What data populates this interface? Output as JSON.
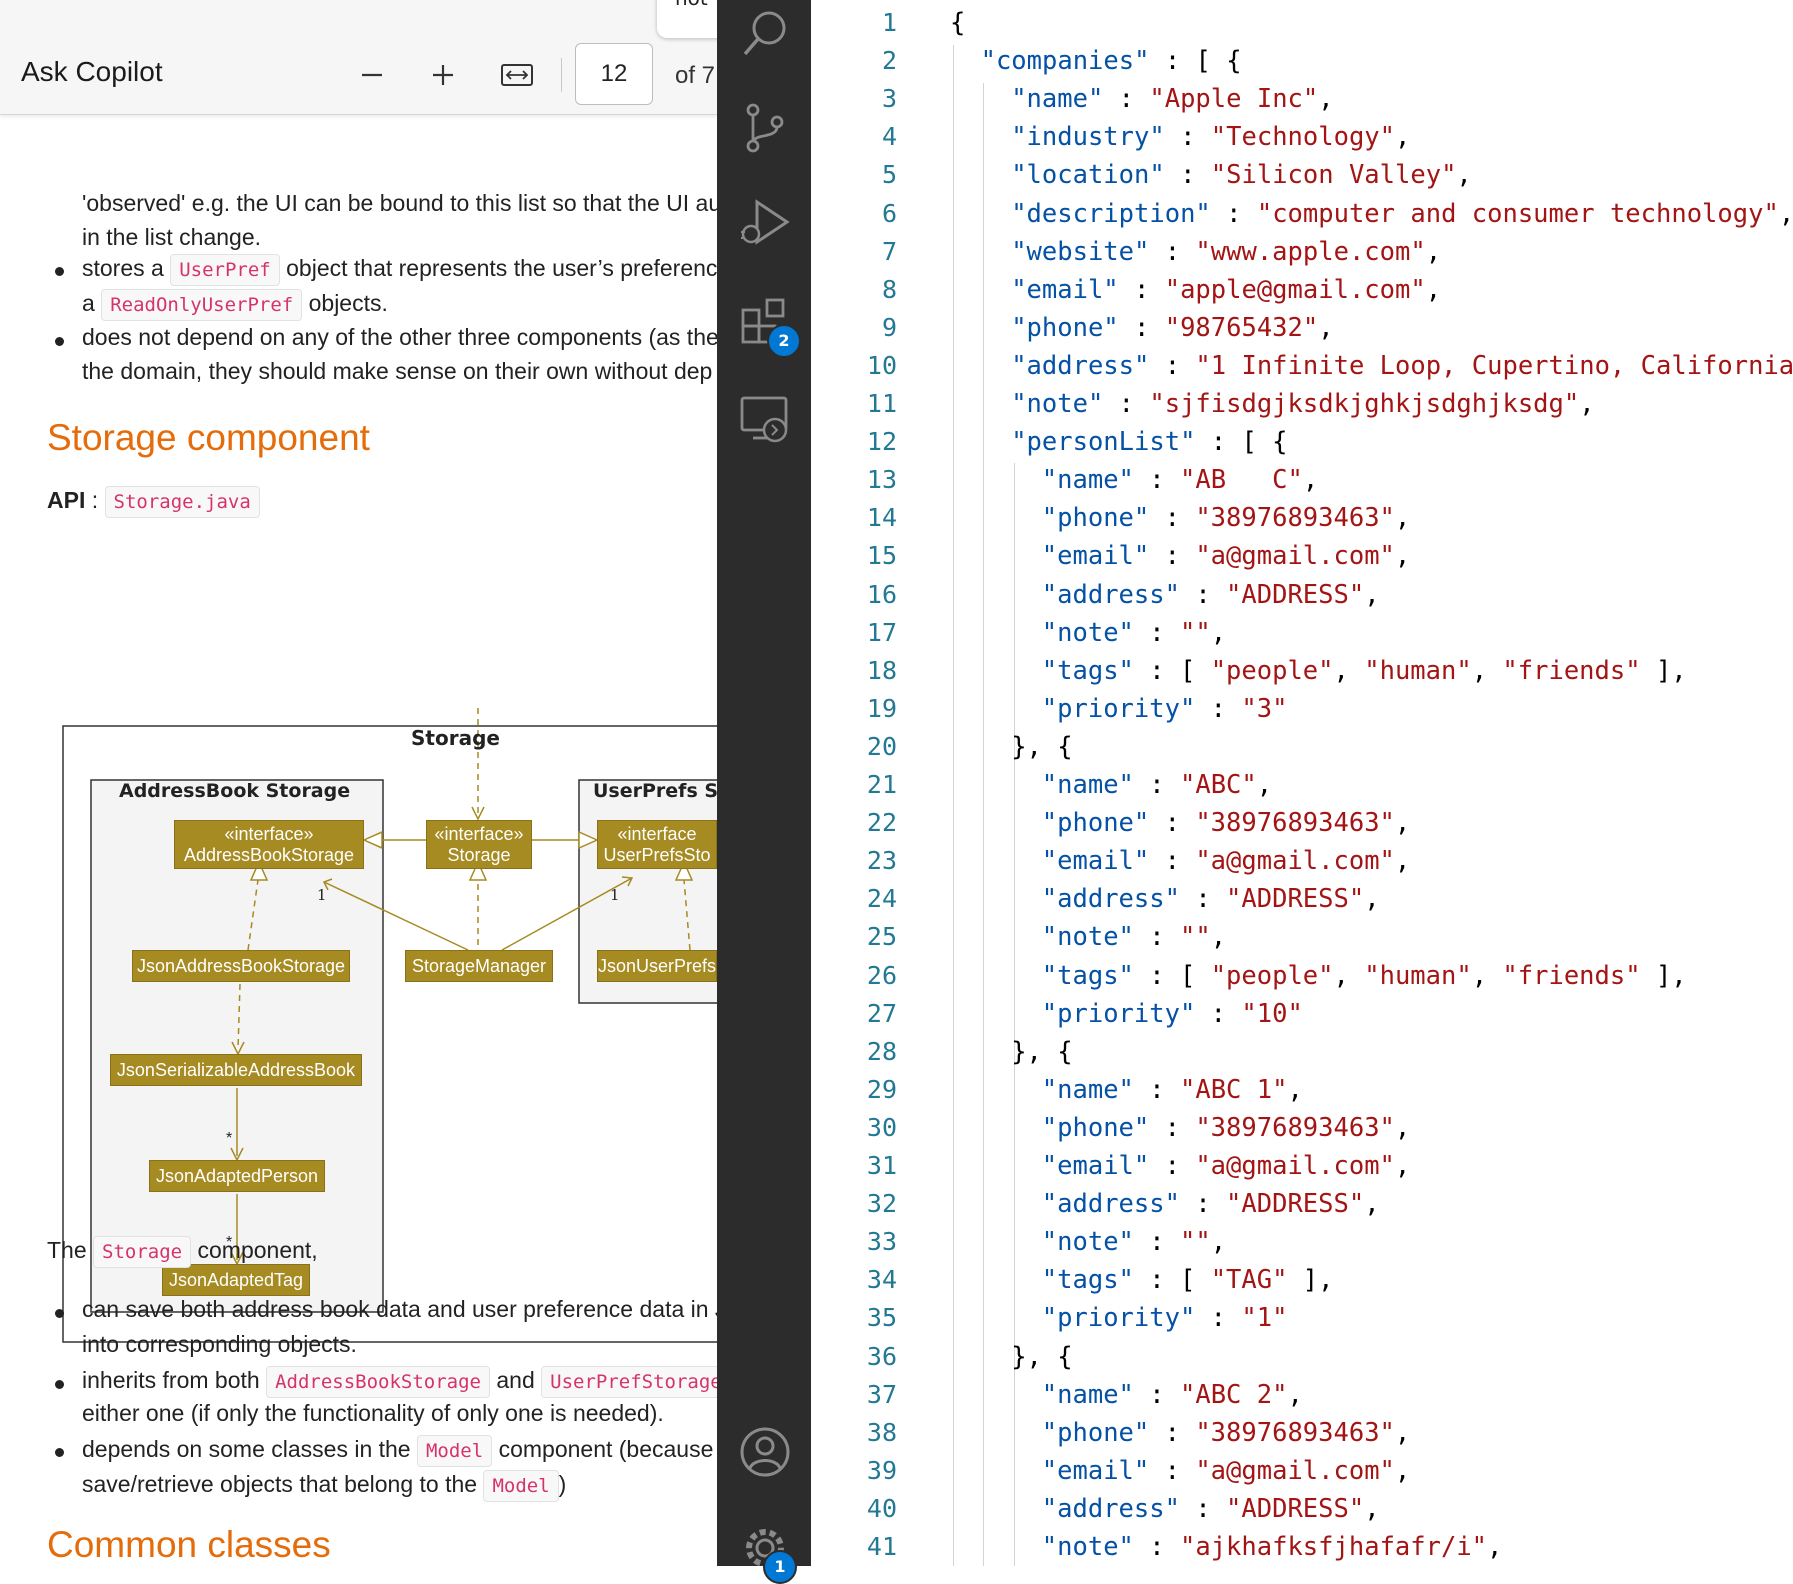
{
  "pdf_toolbar": {
    "tab_stub_text": "not",
    "ask_copilot": "Ask Copilot",
    "zoom_out": "–",
    "zoom_in": "+",
    "page_number": "12",
    "page_of": "of 7"
  },
  "doc": {
    "para1_line1": "'observed' e.g. the UI can be bound to this list so that the UI au",
    "para1_line2": "in the list change.",
    "b1_pre": "stores a",
    "b1_code": "UserPref",
    "b1_post": "object that represents the user’s preference",
    "b1_line2_pre": "a",
    "b1_line2_code": "ReadOnlyUserPref",
    "b1_line2_post": "objects.",
    "b2_line1": "does not depend on any of the other three components (as the",
    "b2_line2": "the domain, they should make sense on their own without dep",
    "storage_heading": "Storage component",
    "api_label": "API",
    "api_sep": ":",
    "api_code": "Storage.java",
    "the_label": "The",
    "storage_code": "Storage",
    "component_label": "component,",
    "c1_line1": "can save both address book data and user preference data in J",
    "c1_line2": "into corresponding objects.",
    "c2_pre": "inherits from both",
    "c2_code1": "AddressBookStorage",
    "c2_and": "and",
    "c2_code2": "UserPrefStorage",
    "c2_line2": "either one (if only the functionality of only one is needed).",
    "c3_pre": "depends on some classes in the",
    "c3_code": "Model",
    "c3_post": "component (because t",
    "c3_line2_pre": "save/retrieve objects that belong to the",
    "c3_line2_code": "Model",
    "c3_line2_post": ")",
    "common_heading": "Common classes"
  },
  "diagram": {
    "outer_title": "Storage",
    "addressbook_pkg": "AddressBook Storage",
    "userprefs_pkg": "UserPrefs S",
    "abs_stereo": "«interface»",
    "abs_name": "AddressBookStorage",
    "storage_stereo": "«interface»",
    "storage_name": "Storage",
    "ups_stereo": "«interface",
    "ups_name": "UserPrefsSto",
    "json_abs": "JsonAddressBookStorage",
    "storage_manager": "StorageManager",
    "json_ups": "JsonUserPrefs",
    "json_sab": "JsonSerializableAddressBook",
    "json_person": "JsonAdaptedPerson",
    "json_tag": "JsonAdaptedTag",
    "mult_one_a": "1",
    "mult_one_b": "1",
    "mult_many_a": "*",
    "mult_many_b": "*"
  },
  "activity_bar": {
    "icons": [
      "search-icon",
      "source-control-icon",
      "run-debug-icon",
      "extensions-icon",
      "remote-explorer-icon",
      "account-icon",
      "settings-gear-icon"
    ],
    "extensions_badge": "2",
    "settings_badge": "1"
  },
  "editor": {
    "lines": [
      {
        "n": "1",
        "indent": 0,
        "segs": [
          [
            "p",
            "{"
          ]
        ]
      },
      {
        "n": "2",
        "indent": 1,
        "segs": [
          [
            "k",
            "\"companies\""
          ],
          [
            "p",
            " : [ {"
          ]
        ]
      },
      {
        "n": "3",
        "indent": 2,
        "segs": [
          [
            "k",
            "\"name\""
          ],
          [
            "p",
            " : "
          ],
          [
            "s",
            "\"Apple Inc\""
          ],
          [
            "p",
            ","
          ]
        ]
      },
      {
        "n": "4",
        "indent": 2,
        "segs": [
          [
            "k",
            "\"industry\""
          ],
          [
            "p",
            " : "
          ],
          [
            "s",
            "\"Technology\""
          ],
          [
            "p",
            ","
          ]
        ]
      },
      {
        "n": "5",
        "indent": 2,
        "segs": [
          [
            "k",
            "\"location\""
          ],
          [
            "p",
            " : "
          ],
          [
            "s",
            "\"Silicon Valley\""
          ],
          [
            "p",
            ","
          ]
        ]
      },
      {
        "n": "6",
        "indent": 2,
        "segs": [
          [
            "k",
            "\"description\""
          ],
          [
            "p",
            " : "
          ],
          [
            "s",
            "\"computer and consumer technology\""
          ],
          [
            "p",
            ","
          ]
        ]
      },
      {
        "n": "7",
        "indent": 2,
        "segs": [
          [
            "k",
            "\"website\""
          ],
          [
            "p",
            " : "
          ],
          [
            "s",
            "\"www.apple.com\""
          ],
          [
            "p",
            ","
          ]
        ]
      },
      {
        "n": "8",
        "indent": 2,
        "segs": [
          [
            "k",
            "\"email\""
          ],
          [
            "p",
            " : "
          ],
          [
            "s",
            "\"apple@gmail.com\""
          ],
          [
            "p",
            ","
          ]
        ]
      },
      {
        "n": "9",
        "indent": 2,
        "segs": [
          [
            "k",
            "\"phone\""
          ],
          [
            "p",
            " : "
          ],
          [
            "s",
            "\"98765432\""
          ],
          [
            "p",
            ","
          ]
        ]
      },
      {
        "n": "10",
        "indent": 2,
        "segs": [
          [
            "k",
            "\"address\""
          ],
          [
            "p",
            " : "
          ],
          [
            "s",
            "\"1 Infinite Loop, Cupertino, California"
          ]
        ]
      },
      {
        "n": "11",
        "indent": 2,
        "segs": [
          [
            "k",
            "\"note\""
          ],
          [
            "p",
            " : "
          ],
          [
            "s",
            "\"sjfisdgjksdkjghkjsdghjksdg\""
          ],
          [
            "p",
            ","
          ]
        ]
      },
      {
        "n": "12",
        "indent": 2,
        "segs": [
          [
            "k",
            "\"personList\""
          ],
          [
            "p",
            " : [ {"
          ]
        ]
      },
      {
        "n": "13",
        "indent": 3,
        "segs": [
          [
            "k",
            "\"name\""
          ],
          [
            "p",
            " : "
          ],
          [
            "s",
            "\"AB   C\""
          ],
          [
            "p",
            ","
          ]
        ]
      },
      {
        "n": "14",
        "indent": 3,
        "segs": [
          [
            "k",
            "\"phone\""
          ],
          [
            "p",
            " : "
          ],
          [
            "s",
            "\"38976893463\""
          ],
          [
            "p",
            ","
          ]
        ]
      },
      {
        "n": "15",
        "indent": 3,
        "segs": [
          [
            "k",
            "\"email\""
          ],
          [
            "p",
            " : "
          ],
          [
            "s",
            "\"a@gmail.com\""
          ],
          [
            "p",
            ","
          ]
        ]
      },
      {
        "n": "16",
        "indent": 3,
        "segs": [
          [
            "k",
            "\"address\""
          ],
          [
            "p",
            " : "
          ],
          [
            "s",
            "\"ADDRESS\""
          ],
          [
            "p",
            ","
          ]
        ]
      },
      {
        "n": "17",
        "indent": 3,
        "segs": [
          [
            "k",
            "\"note\""
          ],
          [
            "p",
            " : "
          ],
          [
            "s",
            "\"\""
          ],
          [
            "p",
            ","
          ]
        ]
      },
      {
        "n": "18",
        "indent": 3,
        "segs": [
          [
            "k",
            "\"tags\""
          ],
          [
            "p",
            " : [ "
          ],
          [
            "s",
            "\"people\""
          ],
          [
            "p",
            ", "
          ],
          [
            "s",
            "\"human\""
          ],
          [
            "p",
            ", "
          ],
          [
            "s",
            "\"friends\""
          ],
          [
            "p",
            " ],"
          ]
        ]
      },
      {
        "n": "19",
        "indent": 3,
        "segs": [
          [
            "k",
            "\"priority\""
          ],
          [
            "p",
            " : "
          ],
          [
            "s",
            "\"3\""
          ]
        ]
      },
      {
        "n": "20",
        "indent": 2,
        "segs": [
          [
            "p",
            "}, {"
          ]
        ]
      },
      {
        "n": "21",
        "indent": 3,
        "segs": [
          [
            "k",
            "\"name\""
          ],
          [
            "p",
            " : "
          ],
          [
            "s",
            "\"ABC\""
          ],
          [
            "p",
            ","
          ]
        ]
      },
      {
        "n": "22",
        "indent": 3,
        "segs": [
          [
            "k",
            "\"phone\""
          ],
          [
            "p",
            " : "
          ],
          [
            "s",
            "\"38976893463\""
          ],
          [
            "p",
            ","
          ]
        ]
      },
      {
        "n": "23",
        "indent": 3,
        "segs": [
          [
            "k",
            "\"email\""
          ],
          [
            "p",
            " : "
          ],
          [
            "s",
            "\"a@gmail.com\""
          ],
          [
            "p",
            ","
          ]
        ]
      },
      {
        "n": "24",
        "indent": 3,
        "segs": [
          [
            "k",
            "\"address\""
          ],
          [
            "p",
            " : "
          ],
          [
            "s",
            "\"ADDRESS\""
          ],
          [
            "p",
            ","
          ]
        ]
      },
      {
        "n": "25",
        "indent": 3,
        "segs": [
          [
            "k",
            "\"note\""
          ],
          [
            "p",
            " : "
          ],
          [
            "s",
            "\"\""
          ],
          [
            "p",
            ","
          ]
        ]
      },
      {
        "n": "26",
        "indent": 3,
        "segs": [
          [
            "k",
            "\"tags\""
          ],
          [
            "p",
            " : [ "
          ],
          [
            "s",
            "\"people\""
          ],
          [
            "p",
            ", "
          ],
          [
            "s",
            "\"human\""
          ],
          [
            "p",
            ", "
          ],
          [
            "s",
            "\"friends\""
          ],
          [
            "p",
            " ],"
          ]
        ]
      },
      {
        "n": "27",
        "indent": 3,
        "segs": [
          [
            "k",
            "\"priority\""
          ],
          [
            "p",
            " : "
          ],
          [
            "s",
            "\"10\""
          ]
        ]
      },
      {
        "n": "28",
        "indent": 2,
        "segs": [
          [
            "p",
            "}, {"
          ]
        ]
      },
      {
        "n": "29",
        "indent": 3,
        "segs": [
          [
            "k",
            "\"name\""
          ],
          [
            "p",
            " : "
          ],
          [
            "s",
            "\"ABC 1\""
          ],
          [
            "p",
            ","
          ]
        ]
      },
      {
        "n": "30",
        "indent": 3,
        "segs": [
          [
            "k",
            "\"phone\""
          ],
          [
            "p",
            " : "
          ],
          [
            "s",
            "\"38976893463\""
          ],
          [
            "p",
            ","
          ]
        ]
      },
      {
        "n": "31",
        "indent": 3,
        "segs": [
          [
            "k",
            "\"email\""
          ],
          [
            "p",
            " : "
          ],
          [
            "s",
            "\"a@gmail.com\""
          ],
          [
            "p",
            ","
          ]
        ]
      },
      {
        "n": "32",
        "indent": 3,
        "segs": [
          [
            "k",
            "\"address\""
          ],
          [
            "p",
            " : "
          ],
          [
            "s",
            "\"ADDRESS\""
          ],
          [
            "p",
            ","
          ]
        ]
      },
      {
        "n": "33",
        "indent": 3,
        "segs": [
          [
            "k",
            "\"note\""
          ],
          [
            "p",
            " : "
          ],
          [
            "s",
            "\"\""
          ],
          [
            "p",
            ","
          ]
        ]
      },
      {
        "n": "34",
        "indent": 3,
        "segs": [
          [
            "k",
            "\"tags\""
          ],
          [
            "p",
            " : [ "
          ],
          [
            "s",
            "\"TAG\""
          ],
          [
            "p",
            " ],"
          ]
        ]
      },
      {
        "n": "35",
        "indent": 3,
        "segs": [
          [
            "k",
            "\"priority\""
          ],
          [
            "p",
            " : "
          ],
          [
            "s",
            "\"1\""
          ]
        ]
      },
      {
        "n": "36",
        "indent": 2,
        "segs": [
          [
            "p",
            "}, {"
          ]
        ]
      },
      {
        "n": "37",
        "indent": 3,
        "segs": [
          [
            "k",
            "\"name\""
          ],
          [
            "p",
            " : "
          ],
          [
            "s",
            "\"ABC 2\""
          ],
          [
            "p",
            ","
          ]
        ]
      },
      {
        "n": "38",
        "indent": 3,
        "segs": [
          [
            "k",
            "\"phone\""
          ],
          [
            "p",
            " : "
          ],
          [
            "s",
            "\"38976893463\""
          ],
          [
            "p",
            ","
          ]
        ]
      },
      {
        "n": "39",
        "indent": 3,
        "segs": [
          [
            "k",
            "\"email\""
          ],
          [
            "p",
            " : "
          ],
          [
            "s",
            "\"a@gmail.com\""
          ],
          [
            "p",
            ","
          ]
        ]
      },
      {
        "n": "40",
        "indent": 3,
        "segs": [
          [
            "k",
            "\"address\""
          ],
          [
            "p",
            " : "
          ],
          [
            "s",
            "\"ADDRESS\""
          ],
          [
            "p",
            ","
          ]
        ]
      },
      {
        "n": "41",
        "indent": 3,
        "segs": [
          [
            "k",
            "\"note\""
          ],
          [
            "p",
            " : "
          ],
          [
            "s",
            "\"ajkhafksfjhafafr/i\""
          ],
          [
            "p",
            ","
          ]
        ]
      }
    ]
  },
  "colors": {
    "accent_orange": "#e46c0a",
    "diagram_gold": "#a68a22",
    "code_pink": "#d6336c",
    "json_key": "#0451a5",
    "json_string": "#a31515",
    "line_number": "#237893",
    "activity_bg": "#2c2c2c",
    "badge_blue": "#0078d4"
  }
}
